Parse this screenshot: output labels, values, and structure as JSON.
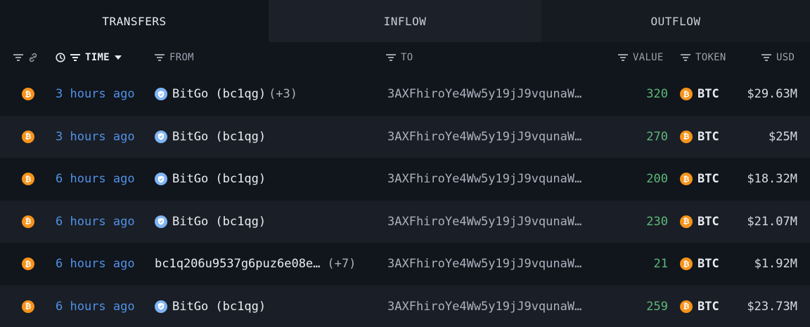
{
  "tabs": [
    {
      "label": "TRANSFERS",
      "active": true
    },
    {
      "label": "INFLOW",
      "active": false
    },
    {
      "label": "OUTFLOW",
      "active": false
    }
  ],
  "columns": {
    "time": "TIME",
    "from": "FROM",
    "to": "TO",
    "value": "VALUE",
    "token": "TOKEN",
    "usd": "USD"
  },
  "icons": {
    "coin": "bitcoin-icon",
    "entity": "verified-shield-icon",
    "filter": "filter-icon",
    "link": "link-icon",
    "clock": "clock-icon",
    "sort": "caret-down-icon"
  },
  "colors": {
    "background": "#11151c",
    "row_alt": "#1a1e26",
    "time_link": "#4f92e6",
    "value_green": "#5cb97a",
    "btc_orange": "#f7931a",
    "entity_blue": "#7fb5f5"
  },
  "rows": [
    {
      "time": "3 hours ago",
      "from": "BitGo (bc1qg)",
      "from_extra": "(+3)",
      "to": "3AXFhiroYe4Ww5y19jJ9vqunaW…",
      "value": "320",
      "token": "BTC",
      "usd": "$29.63M"
    },
    {
      "time": "3 hours ago",
      "from": "BitGo (bc1qg)",
      "from_extra": "",
      "to": "3AXFhiroYe4Ww5y19jJ9vqunaW…",
      "value": "270",
      "token": "BTC",
      "usd": "$25M"
    },
    {
      "time": "6 hours ago",
      "from": "BitGo (bc1qg)",
      "from_extra": "",
      "to": "3AXFhiroYe4Ww5y19jJ9vqunaW…",
      "value": "200",
      "token": "BTC",
      "usd": "$18.32M"
    },
    {
      "time": "6 hours ago",
      "from": "BitGo (bc1qg)",
      "from_extra": "",
      "to": "3AXFhiroYe4Ww5y19jJ9vqunaW…",
      "value": "230",
      "token": "BTC",
      "usd": "$21.07M"
    },
    {
      "time": "6 hours ago",
      "from": "bc1q206u9537g6puz6e08e…",
      "from_extra": "(+7)",
      "to": "3AXFhiroYe4Ww5y19jJ9vqunaW…",
      "value": "21",
      "token": "BTC",
      "usd": "$1.92M"
    },
    {
      "time": "6 hours ago",
      "from": "BitGo (bc1qg)",
      "from_extra": "",
      "to": "3AXFhiroYe4Ww5y19jJ9vqunaW…",
      "value": "259",
      "token": "BTC",
      "usd": "$23.73M"
    }
  ]
}
